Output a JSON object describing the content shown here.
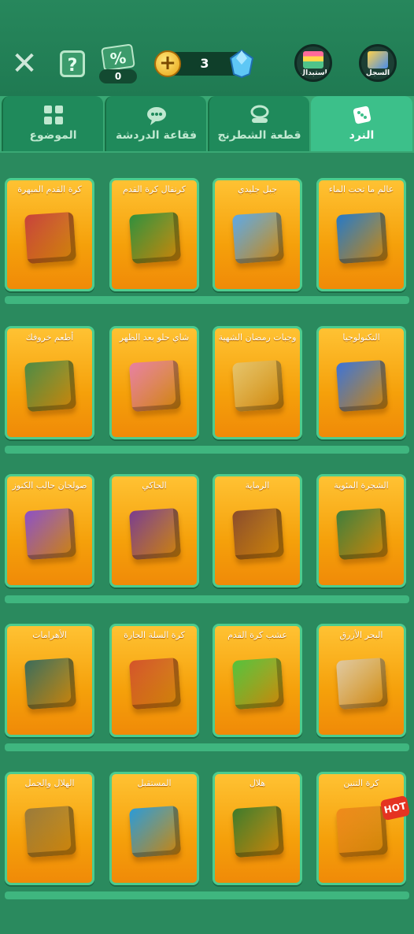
{
  "header": {
    "close_icon": "close-icon",
    "help_label": "?",
    "discount_label": "%",
    "discount_count": "0",
    "coin_plus": "+",
    "coin_count": "3",
    "exchange_label": "استبدال",
    "history_label": "السجل"
  },
  "tabs": [
    {
      "label": "الموضوع",
      "icon": "theme-grid-icon",
      "active": false
    },
    {
      "label": "فقاعة الدردشة",
      "icon": "chat-bubble-icon",
      "active": false
    },
    {
      "label": "قطعة الشطرنج",
      "icon": "chess-piece-icon",
      "active": false
    },
    {
      "label": "النرد",
      "icon": "dice-icon",
      "active": true
    }
  ],
  "rows": [
    [
      {
        "title": "كرة القدم المبهرة",
        "color": "#c8413a"
      },
      {
        "title": "كرنفال كرة القدم",
        "color": "#2f8f3c"
      },
      {
        "title": "جبل جليدي",
        "color": "#5ca8e8"
      },
      {
        "title": "عالم ما تحت الماء",
        "color": "#2478c8"
      }
    ],
    [
      {
        "title": "أطعم خروفك",
        "color": "#4c8a44"
      },
      {
        "title": "شاي حلو بعد الظهر",
        "color": "#e87fa2"
      },
      {
        "title": "وجبات رمضان الشهية",
        "color": "#e6c36a"
      },
      {
        "title": "التكنولوجيا",
        "color": "#3b72d8"
      }
    ],
    [
      {
        "title": "صولجان حالب الكنوز",
        "color": "#8c4fc7"
      },
      {
        "title": "الحاكي",
        "color": "#7a3c8e"
      },
      {
        "title": "الرماية",
        "color": "#8a4a2a"
      },
      {
        "title": "الشجرة المئوية",
        "color": "#3f7d3a"
      }
    ],
    [
      {
        "title": "الأهرامات",
        "color": "#3a6b5a"
      },
      {
        "title": "كرة السلة الحارة",
        "color": "#d4532a"
      },
      {
        "title": "عشب كرة القدم",
        "color": "#54c23c"
      },
      {
        "title": "البحر الأزرق",
        "color": "#e0c8a0"
      }
    ],
    [
      {
        "title": "الهلال والجمل",
        "color": "#9a7a3a"
      },
      {
        "title": "المستقبل",
        "color": "#2a9ad8"
      },
      {
        "title": "هلال",
        "color": "#3d7a2a"
      },
      {
        "title": "كرة التنين",
        "color": "#f08a1a",
        "badge": "HOT"
      }
    ]
  ]
}
